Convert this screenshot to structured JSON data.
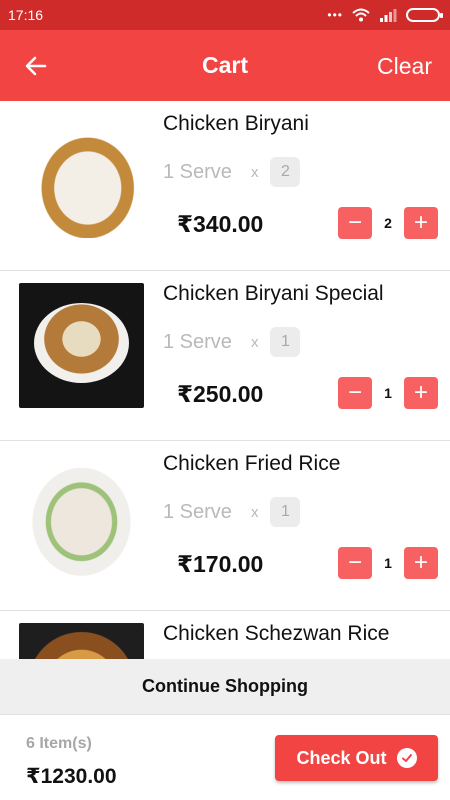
{
  "statusbar": {
    "time": "17:16"
  },
  "appbar": {
    "title": "Cart",
    "clear_label": "Clear"
  },
  "colors": {
    "primary": "#f14443",
    "statusbar": "#cf2b2b",
    "stepper": "#f86161"
  },
  "cart_items": [
    {
      "name": "Chicken Biryani",
      "serve": "1 Serve",
      "times": "x",
      "serve_qty": "2",
      "price": "₹340.00",
      "qty": "2",
      "minus": "−",
      "plus": "+"
    },
    {
      "name": "Chicken Biryani Special",
      "serve": "1 Serve",
      "times": "x",
      "serve_qty": "1",
      "price": "₹250.00",
      "qty": "1",
      "minus": "−",
      "plus": "+"
    },
    {
      "name": "Chicken Fried Rice",
      "serve": "1 Serve",
      "times": "x",
      "serve_qty": "1",
      "price": "₹170.00",
      "qty": "1",
      "minus": "−",
      "plus": "+"
    },
    {
      "name": "Chicken Schezwan Rice",
      "serve": "",
      "times": "",
      "serve_qty": "",
      "price": "",
      "qty": "",
      "minus": "",
      "plus": ""
    }
  ],
  "continue_label": "Continue Shopping",
  "footer": {
    "items_count": "6 Item(s)",
    "total": "₹1230.00",
    "checkout_label": "Check Out"
  },
  "icons": {
    "back": "arrow-left-icon",
    "checkout": "check-circle-icon"
  }
}
